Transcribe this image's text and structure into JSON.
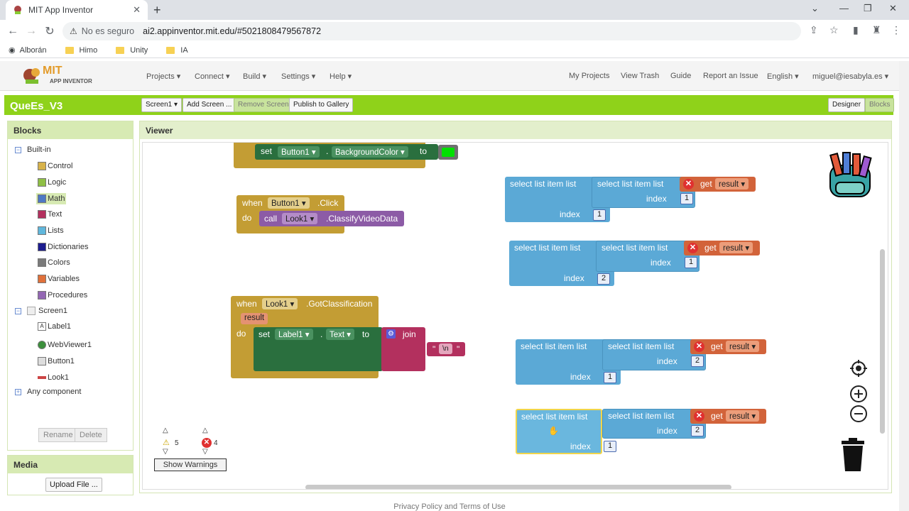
{
  "browser": {
    "tab_title": "MIT App Inventor",
    "security": "No es seguro",
    "url": "ai2.appinventor.mit.edu/#5021808479567872",
    "bookmarks": [
      "Alborán",
      "Himo",
      "Unity",
      "IA"
    ]
  },
  "topnav": {
    "brand_line1": "MIT",
    "brand_line2": "APP INVENTOR",
    "menus": [
      "Projects ▾",
      "Connect ▾",
      "Build ▾",
      "Settings ▾",
      "Help ▾"
    ],
    "right": [
      "My Projects",
      "View Trash",
      "Guide",
      "Report an Issue",
      "English ▾",
      "miguel@iesabyla.es ▾"
    ]
  },
  "toolbar": {
    "project": "QueEs_V3",
    "screen": "Screen1 ▾",
    "add_screen": "Add Screen ...",
    "remove_screen": "Remove Screen",
    "publish": "Publish to Gallery",
    "designer": "Designer",
    "blocks": "Blocks"
  },
  "blocks_panel": {
    "title": "Blocks",
    "builtin": "Built-in",
    "items": [
      {
        "label": "Control",
        "color": "#d7b24a"
      },
      {
        "label": "Logic",
        "color": "#8fbf45"
      },
      {
        "label": "Math",
        "color": "#4e79c4"
      },
      {
        "label": "Text",
        "color": "#b3305e"
      },
      {
        "label": "Lists",
        "color": "#60b7dc"
      },
      {
        "label": "Dictionaries",
        "color": "#1d1d8f"
      },
      {
        "label": "Colors",
        "color": "#7a7a7a"
      },
      {
        "label": "Variables",
        "color": "#e0703a"
      },
      {
        "label": "Procedures",
        "color": "#9367b3"
      }
    ],
    "screen": "Screen1",
    "components": [
      "Label1",
      "WebViewer1",
      "Button1",
      "Look1"
    ],
    "any_component": "Any component",
    "rename": "Rename",
    "delete": "Delete"
  },
  "media_panel": {
    "title": "Media",
    "upload": "Upload File ..."
  },
  "viewer": {
    "title": "Viewer",
    "set_block": {
      "set": "set",
      "component": "Button1 ▾",
      "dot": ".",
      "prop": "BackgroundColor ▾",
      "to": "to"
    },
    "click_event": {
      "when": "when",
      "component": "Button1 ▾",
      "event": ".Click",
      "do": "do",
      "call": "call",
      "target": "Look1 ▾",
      "method": ".ClassifyVideoData"
    },
    "classification_event": {
      "when": "when",
      "component": "Look1 ▾",
      "event": ".GotClassification",
      "param": "result",
      "do": "do",
      "set": "set",
      "target": "Label1 ▾",
      "dot": ".",
      "prop": "Text ▾",
      "to": "to",
      "join": "join",
      "text": "\\n"
    },
    "list_blocks": [
      {
        "outer_index": "1",
        "inner_index": "1"
      },
      {
        "outer_index": "2",
        "inner_index": "1"
      },
      {
        "outer_index": "1",
        "inner_index": "2"
      },
      {
        "outer_index": "1",
        "inner_index": "2"
      }
    ],
    "labels": {
      "select": "select list item  list",
      "index": "index",
      "get": "get",
      "result": "result ▾"
    },
    "warnings": {
      "count": "5",
      "errors": "4",
      "button": "Show Warnings"
    }
  },
  "footer": "Privacy Policy and Terms of Use",
  "colors": {
    "green": "#8fd21a",
    "control": "#c39d34",
    "component": "#2a6f3e",
    "list": "#5ba9d6",
    "get": "#d2633a",
    "text": "#b3305e"
  }
}
